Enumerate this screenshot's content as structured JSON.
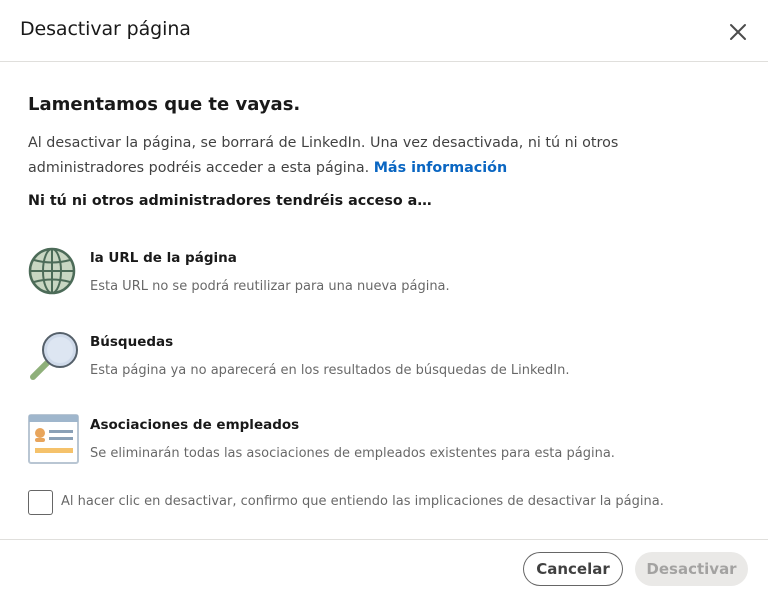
{
  "dialog": {
    "title": "Desactivar página",
    "close_icon": "close-icon"
  },
  "main": {
    "headline": "Lamentamos que te vayas.",
    "description": "Al desactivar la página, se borrará de LinkedIn. Una vez desactivada, ni tú ni otros administradores podréis acceder a esta página.",
    "learn_more": "Más información",
    "subhead": "Ni tú ni otros administradores tendréis acceso a…",
    "items": [
      {
        "icon": "globe-icon",
        "title": "la URL de la página",
        "description": "Esta URL no se podrá reutilizar para una nueva página."
      },
      {
        "icon": "magnifier-icon",
        "title": "Búsquedas",
        "description": "Esta página ya no aparecerá en los resultados de búsquedas de LinkedIn."
      },
      {
        "icon": "employee-card-icon",
        "title": "Asociaciones de empleados",
        "description": "Se eliminarán todas las asociaciones de empleados existentes para esta página."
      }
    ]
  },
  "confirm": {
    "checked": false,
    "label": "Al hacer clic en desactivar, confirmo que entiendo las implicaciones de desactivar la página."
  },
  "footer": {
    "cancel_label": "Cancelar",
    "deactivate_label": "Desactivar",
    "deactivate_enabled": false
  },
  "colors": {
    "link": "#0a66c2",
    "globe_fill": "#c8d6c2",
    "globe_stroke": "#4c6b58",
    "magnifier_lens": "#cfdaea",
    "magnifier_handle": "#8fb07a",
    "card_bar": "#f5c26b",
    "card_header": "#9fb6cc"
  }
}
